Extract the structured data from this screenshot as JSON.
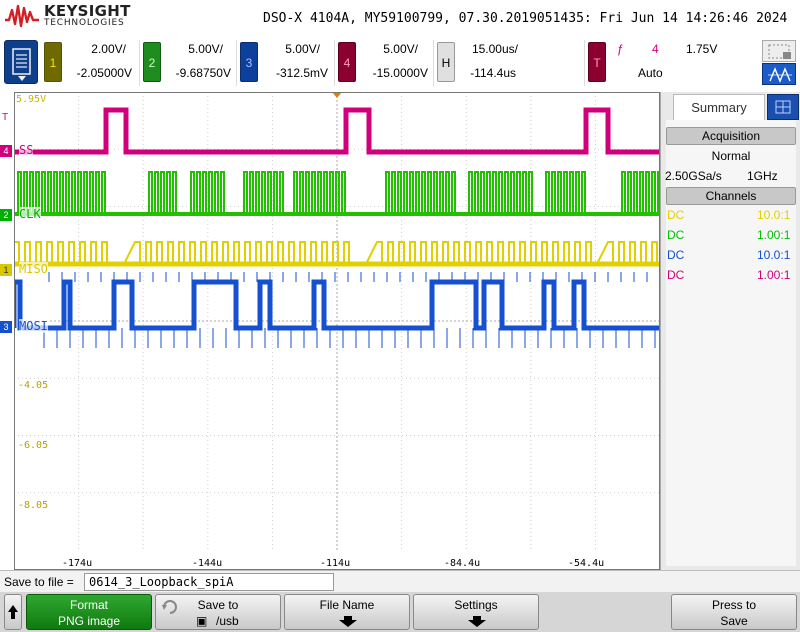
{
  "header": {
    "brand": "KEYSIGHT",
    "brand_sub": "TECHNOLOGIES",
    "title": "DSO-X 4104A, MY59100799, 07.30.2019051435: Fri Jun 14 14:26:46 2024"
  },
  "channels": [
    {
      "num": "1",
      "scale": "2.00V/",
      "offset": "-2.05000V",
      "color": "#e0d000",
      "tab_bg": "#f5ee7a"
    },
    {
      "num": "2",
      "scale": "5.00V/",
      "offset": "-9.68750V",
      "color": "#00c000",
      "tab_bg": "#3fc73f"
    },
    {
      "num": "3",
      "scale": "5.00V/",
      "offset": "-312.5mV",
      "color": "#1450d0",
      "tab_bg": "#1c4fb8"
    },
    {
      "num": "4",
      "scale": "5.00V/",
      "offset": "-15.0000V",
      "color": "#d0007c",
      "tab_bg": "#a0003c"
    }
  ],
  "horizontal": {
    "label": "H",
    "scale": "15.00us/",
    "delay": "-114.4us"
  },
  "trigger": {
    "label": "T",
    "slope": "ƒ",
    "source": "4",
    "level": "1.75V",
    "mode": "Auto"
  },
  "display": {
    "top_label": "5.95V",
    "y_labels": [
      "-4.05",
      "-6.05",
      "-8.05"
    ],
    "x_labels": [
      "-174u",
      "-144u",
      "-114u",
      "-84.4u",
      "-54.4u"
    ],
    "trace_labels": {
      "ch4": "SS",
      "ch2": "CLK",
      "ch1": "MISO",
      "ch3": "MOSI"
    },
    "marker_labels": {
      "ch4": "4",
      "ch2": "2",
      "ch1": "1",
      "ch3": "3",
      "trig": "T"
    }
  },
  "summary_panel": {
    "tab": "Summary",
    "acquisition_header": "Acquisition",
    "mode": "Normal",
    "sample_rate": "2.50GSa/s",
    "bandwidth": "1GHz",
    "channels_header": "Channels",
    "channel_rows": [
      {
        "coupling": "DC",
        "probe": "10.0:1",
        "color": "#e0d000"
      },
      {
        "coupling": "DC",
        "probe": "1.00:1",
        "color": "#00c000"
      },
      {
        "coupling": "DC",
        "probe": "10.0:1",
        "color": "#1450d0"
      },
      {
        "coupling": "DC",
        "probe": "1.00:1",
        "color": "#d0007c"
      }
    ]
  },
  "save": {
    "label": "Save to file =",
    "filename": "0614_3_Loopback_spiA"
  },
  "softkeys": {
    "format_title": "Format",
    "format_value": "PNG image",
    "saveto_title": "Save to",
    "saveto_value": "/usb",
    "filename_title": "File Name",
    "settings_title": "Settings",
    "press_line1": "Press to",
    "press_line2": "Save"
  }
}
